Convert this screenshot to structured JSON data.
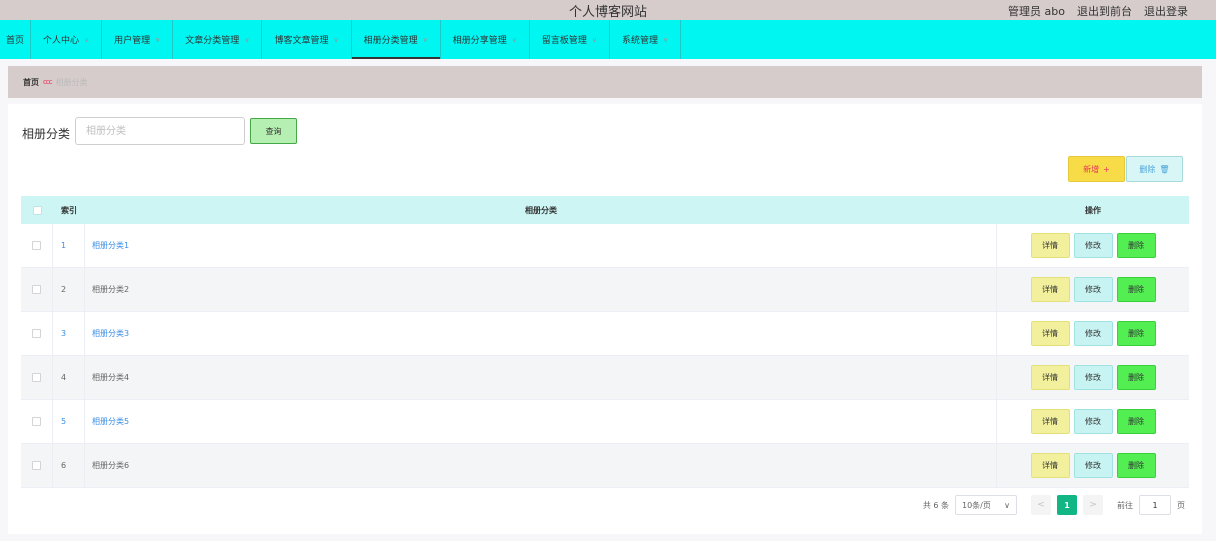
{
  "header": {
    "site_title": "个人博客网站",
    "admin_label": "管理员 abo",
    "to_front": "退出到前台",
    "logout": "退出登录"
  },
  "nav": {
    "items": [
      {
        "label": "首页"
      },
      {
        "label": "个人中心"
      },
      {
        "label": "用户管理"
      },
      {
        "label": "文章分类管理"
      },
      {
        "label": "博客文章管理"
      },
      {
        "label": "相册分类管理"
      },
      {
        "label": "相册分享管理"
      },
      {
        "label": "留言板管理"
      },
      {
        "label": "系统管理"
      }
    ],
    "chevron": "∨"
  },
  "breadcrumb": {
    "home": "首页",
    "separator": "ccc",
    "current": "相册分类"
  },
  "search": {
    "label": "相册分类",
    "placeholder": "相册分类",
    "button": "查询"
  },
  "actions": {
    "add": "新增",
    "add_icon": "+",
    "delete": "删除",
    "delete_icon": "🗑"
  },
  "table": {
    "headers": {
      "index": "索引",
      "name": "相册分类",
      "ops": "操作"
    },
    "rows": [
      {
        "index": "1",
        "name": "相册分类1"
      },
      {
        "index": "2",
        "name": "相册分类2"
      },
      {
        "index": "3",
        "name": "相册分类3"
      },
      {
        "index": "4",
        "name": "相册分类4"
      },
      {
        "index": "5",
        "name": "相册分类5"
      },
      {
        "index": "6",
        "name": "相册分类6"
      }
    ],
    "op_labels": {
      "detail": "详情",
      "edit": "修改",
      "remove": "删除"
    }
  },
  "pagination": {
    "total": "共 6 条",
    "page_size": "10条/页",
    "prev": "<",
    "current": "1",
    "next": ">",
    "goto_prefix": "前往",
    "goto_value": "1",
    "goto_suffix": "页"
  },
  "colors": {
    "topbar": "#d7cccc",
    "navbar": "#00f6f0",
    "table_header": "#ccf5f3",
    "add_button": "#f8dc47",
    "remove_button": "#52ee52",
    "pager_active": "#12b584"
  }
}
